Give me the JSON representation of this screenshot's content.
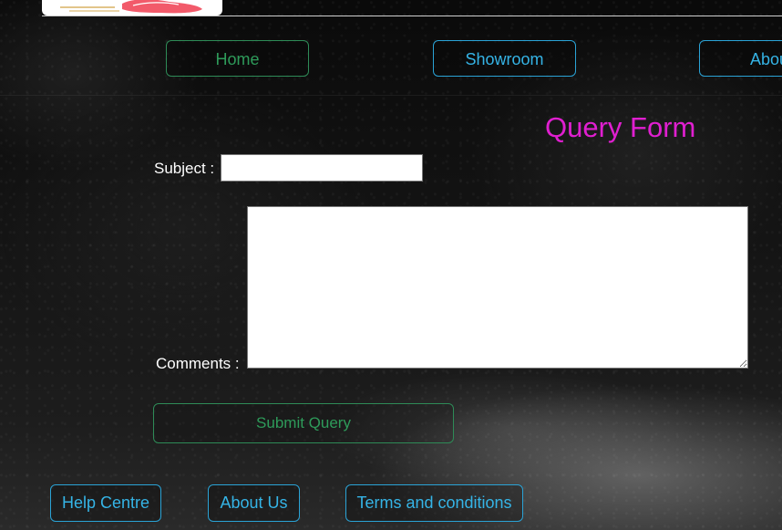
{
  "nav": {
    "home_label": "Home",
    "showroom_label": "Showroom",
    "about_label": "About"
  },
  "form": {
    "title": "Query Form",
    "subject_label": "Subject :",
    "subject_value": "",
    "comments_label": "Comments :",
    "comments_value": "",
    "submit_label": "Submit Query"
  },
  "footer": {
    "help_label": "Help Centre",
    "about_label": "About Us",
    "terms_label": "Terms and conditions"
  },
  "colors": {
    "title_magenta": "#e01fd0",
    "green_accent": "#2e9b5a",
    "blue_accent": "#35b4e6"
  }
}
